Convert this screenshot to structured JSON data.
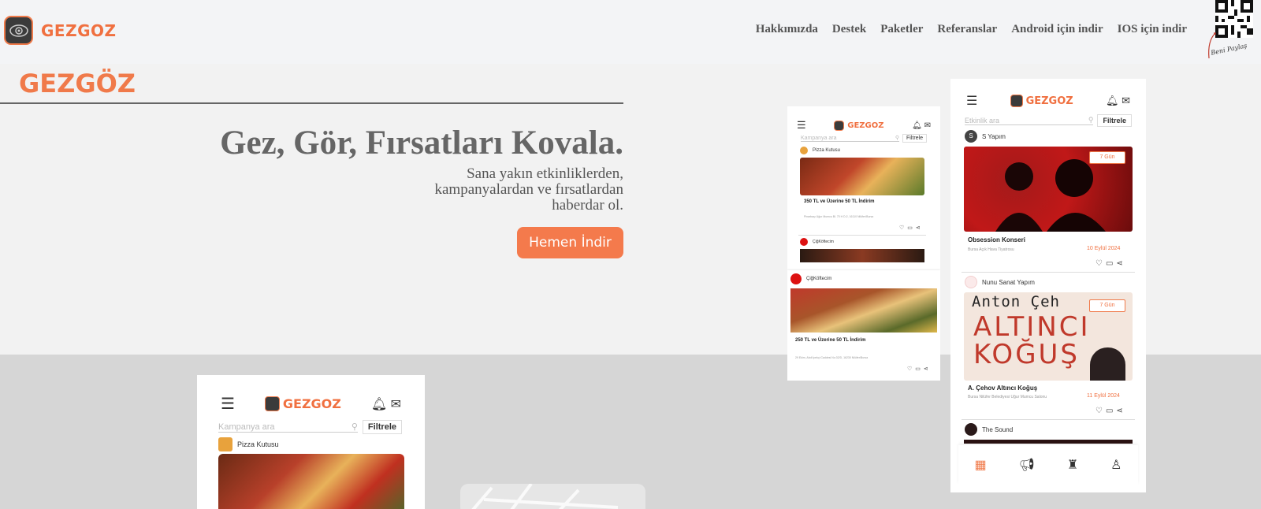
{
  "brand": {
    "name": "GEZGOZ",
    "hero_name": "GEZGÖZ"
  },
  "nav": [
    "Hakkımızda",
    "Destek",
    "Paketler",
    "Referanslar",
    "Android için indir",
    "IOS için indir"
  ],
  "qr": {
    "caption": "Beni Paylaş"
  },
  "hero": {
    "title": "Gez, Gör, Fırsatları Kovala.",
    "subtitle_line1": "Sana yakın etkinliklerden,",
    "subtitle_line2": "kampanyalardan ve fırsatlardan",
    "subtitle_line3": "haberdar ol.",
    "cta": "Hemen İndir"
  },
  "phone_a": {
    "logo": "GEZGOZ",
    "search_placeholder": "Kampanya ara",
    "filter": "Filtrele",
    "card1": {
      "channel": "Pizza Kutusu",
      "title": "350 TL ve Üzerine 50 TL İndirim",
      "meta": "Pinarbaşı Uğur Mumcu Bl. 70 H D:2, 16110 Nilüfer/Bursa"
    },
    "card2": {
      "channel": "ÇiğKöftecim",
      "title": "250 TL ve Üzerine 50 TL İndirim",
      "meta": "29 Ekim, Abdi İpekçi Caddesi No:32/D, 16230 Nilüfer/Bursa"
    }
  },
  "phone_b": {
    "logo": "GEZGOZ",
    "search_placeholder": "Etkinlik ara",
    "filter": "Filtrele",
    "card1": {
      "channel_initial": "S",
      "channel": "S Yapım",
      "badge": "7 Gün",
      "title": "Obsession Konseri",
      "meta": "Bursa Açık Hava Tiyatrosu",
      "date": "10 Eylül 2024"
    },
    "card2": {
      "channel": "Nunu Sanat Yapım",
      "badge": "7 Gün",
      "poster_top": "Anton Çeh",
      "poster_mid": "ALTINCI",
      "poster_bot": "KOĞUŞ",
      "title": "A. Çehov Altıncı Koğuş",
      "meta": "Bursa Nilüfer Belediyesi Uğur Mumcu Salonu",
      "date": "11 Eylül 2024"
    },
    "card3": {
      "channel": "The Sound"
    }
  },
  "phone_c": {
    "logo": "GEZGOZ",
    "search_placeholder": "Kampanya ara",
    "filter": "Filtrele",
    "channel": "Pizza Kutusu"
  },
  "colors": {
    "accent": "#f07a4a",
    "dark": "#3b3b3b"
  }
}
